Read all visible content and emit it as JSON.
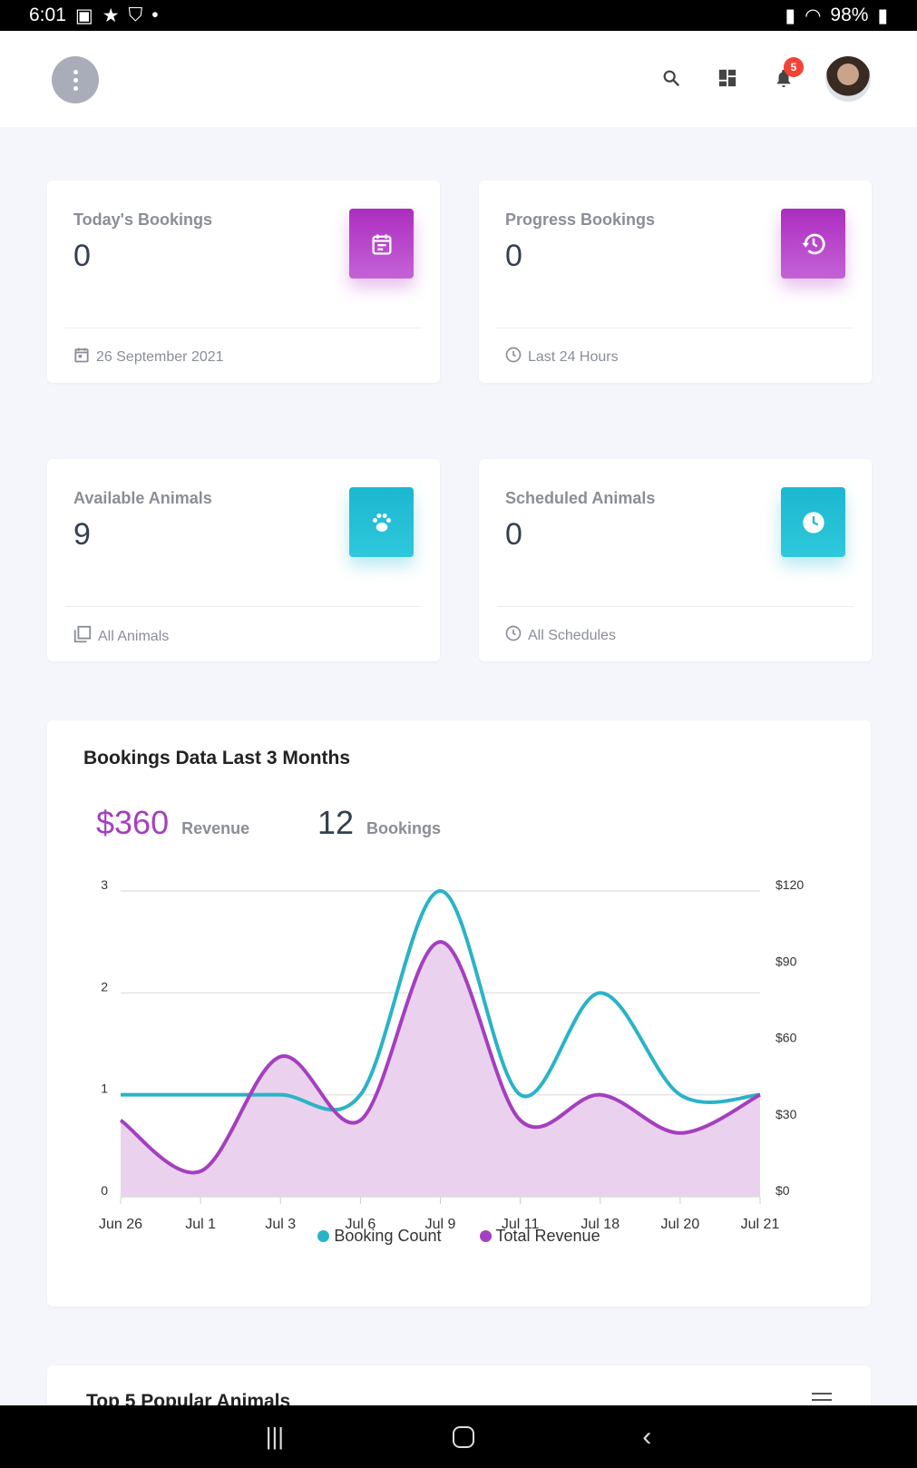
{
  "status_bar": {
    "time": "6:01",
    "battery": "98%"
  },
  "header": {
    "notification_count": "5"
  },
  "cards": [
    {
      "title": "Today's Bookings",
      "value": "0",
      "footer": "26 September 2021",
      "icon": "calendar-icon",
      "footer_icon": "calendar-icon",
      "color": "purple"
    },
    {
      "title": "Progress Bookings",
      "value": "0",
      "footer": "Last 24 Hours",
      "icon": "history-icon",
      "footer_icon": "clock-icon",
      "color": "purple"
    },
    {
      "title": "Available Animals",
      "value": "9",
      "footer": "All Animals",
      "icon": "paw-icon",
      "footer_icon": "library-icon",
      "color": "cyan"
    },
    {
      "title": "Scheduled Animals",
      "value": "0",
      "footer": "All Schedules",
      "icon": "clock-icon",
      "footer_icon": "clock-icon",
      "color": "cyan"
    }
  ],
  "bookings_chart": {
    "title": "Bookings Data Last 3 Months",
    "revenue_value": "$360",
    "revenue_label": "Revenue",
    "bookings_value": "12",
    "bookings_label": "Bookings"
  },
  "chart_data": {
    "type": "line",
    "categories": [
      "Jun 26",
      "Jul 1",
      "Jul 3",
      "Jul 6",
      "Jul 9",
      "Jul 11",
      "Jul 18",
      "Jul 20",
      "Jul 21"
    ],
    "series": [
      {
        "name": "Booking Count",
        "axis": "left",
        "color": "#2ab3c6",
        "values": [
          1,
          1,
          1,
          1,
          3,
          1,
          2,
          1,
          1
        ]
      },
      {
        "name": "Total Revenue",
        "axis": "right",
        "color": "#a43fbf",
        "fill": "#ead2ee",
        "values": [
          30,
          10,
          55,
          30,
          100,
          30,
          40,
          25,
          40
        ]
      }
    ],
    "y_left": {
      "ticks": [
        "0",
        "1",
        "2",
        "3"
      ],
      "range": [
        0,
        3
      ]
    },
    "y_right": {
      "ticks": [
        "$0",
        "$30",
        "$60",
        "$90",
        "$120"
      ],
      "range": [
        0,
        120
      ]
    },
    "grid": true,
    "smooth": true,
    "legend": "bottom"
  },
  "next_section": {
    "title": "Top 5 Popular Animals"
  }
}
